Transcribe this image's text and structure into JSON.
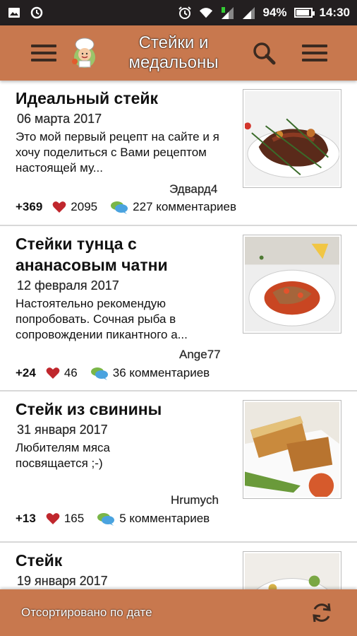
{
  "status_bar": {
    "battery_percent": "94%",
    "battery_level": 0.94,
    "time": "14:30",
    "icons": [
      "image-icon",
      "sync-icon",
      "alarm-icon",
      "wifi-icon",
      "signal-icon",
      "signal-icon-2",
      "battery-icon"
    ]
  },
  "toolbar": {
    "title": "Стейки и медальоны",
    "menu_icon": "hamburger-icon",
    "search_icon": "search-icon",
    "overflow_icon": "hamburger-icon"
  },
  "colors": {
    "accent": "#c8784e",
    "status_bar": "#231f20",
    "heart": "#c0272d"
  },
  "recipes": [
    {
      "title": "Идеальный стейк",
      "date": "06 марта 2017",
      "description": "Это мой первый рецепт на сайте и я хочу поделиться с Вами рецептом настоящей му...",
      "author": "Эдвард4",
      "score": "+369",
      "likes": "2095",
      "comments": "227 комментариев"
    },
    {
      "title": "Стейки тунца с ананасовым чатни",
      "date": "12 февраля 2017",
      "description": "Настоятельно рекомендую попробовать. Сочная рыба в сопровождении пикантного а...",
      "author": "Ange77",
      "score": "+24",
      "likes": "46",
      "comments": "36 комментариев"
    },
    {
      "title": "Стейк из свинины",
      "date": "31 января 2017",
      "description": "Любителям мяса посвящается ;-)",
      "author": "Hrumych",
      "score": "+13",
      "likes": "165",
      "comments": "5 комментариев"
    },
    {
      "title": "Стейк",
      "date": "19 января 2017",
      "description": "",
      "author": "",
      "score": "",
      "likes": "",
      "comments": ""
    }
  ],
  "bottom_bar": {
    "sort_label": "Отсортировано по дате",
    "refresh_icon": "refresh-icon"
  }
}
